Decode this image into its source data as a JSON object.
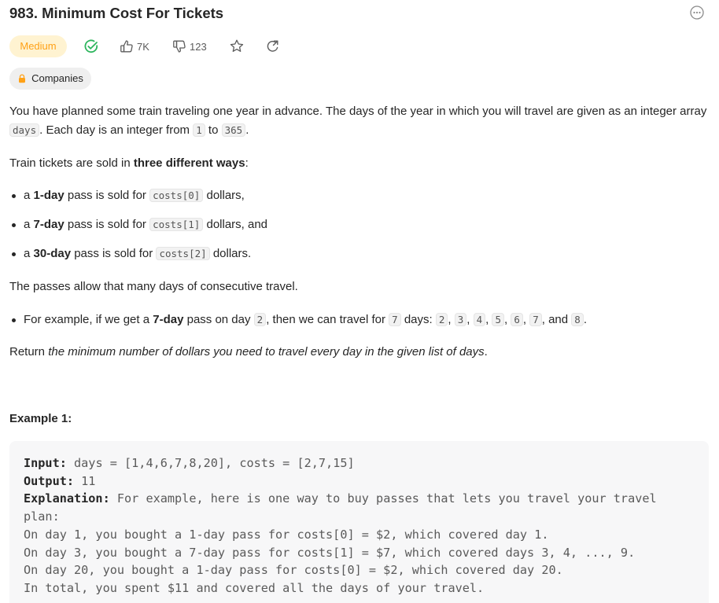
{
  "problem": {
    "title": "983. Minimum Cost For Tickets",
    "difficulty": "Medium",
    "likes": "7K",
    "dislikes": "123",
    "companies_label": "Companies"
  },
  "description": {
    "p1_a": "You have planned some train traveling one year in advance. The days of the year in which you will travel are given as an integer array ",
    "p1_code1": "days",
    "p1_b": ". Each day is an integer from ",
    "p1_code2": "1",
    "p1_c": " to ",
    "p1_code3": "365",
    "p1_d": ".",
    "p2_a": "Train tickets are sold in ",
    "p2_bold": "three different ways",
    "p2_b": ":",
    "passes": [
      {
        "pre": "a ",
        "bold": "1-day",
        "mid": " pass is sold for ",
        "code": "costs[0]",
        "post": " dollars,"
      },
      {
        "pre": "a ",
        "bold": "7-day",
        "mid": " pass is sold for ",
        "code": "costs[1]",
        "post": " dollars, and"
      },
      {
        "pre": "a ",
        "bold": "30-day",
        "mid": " pass is sold for ",
        "code": "costs[2]",
        "post": " dollars."
      }
    ],
    "p3": "The passes allow that many days of consecutive travel.",
    "example_bullet": {
      "a": "For example, if we get a ",
      "bold": "7-day",
      "b": " pass on day ",
      "code_day": "2",
      "c": ", then we can travel for ",
      "code_count": "7",
      "d": " days: ",
      "days": [
        "2",
        "3",
        "4",
        "5",
        "6",
        "7"
      ],
      "and": ", and ",
      "last": "8",
      "end": "."
    },
    "p4_a": "Return ",
    "p4_italic": "the minimum number of dollars you need to travel every day in the given list of days",
    "p4_b": "."
  },
  "example1": {
    "heading": "Example 1:",
    "input_label": "Input:",
    "input_value": " days = [1,4,6,7,8,20], costs = [2,7,15]",
    "output_label": "Output:",
    "output_value": " 11",
    "explanation_label": "Explanation:",
    "explanation_lines": [
      " For example, here is one way to buy passes that lets you travel your travel",
      "plan:",
      "On day 1, you bought a 1-day pass for costs[0] = $2, which covered day 1.",
      "On day 3, you bought a 7-day pass for costs[1] = $7, which covered days 3, 4, ..., 9.",
      "On day 20, you bought a 1-day pass for costs[0] = $2, which covered day 20.",
      "In total, you spent $11 and covered all the days of your travel."
    ]
  },
  "icons": {
    "more": "more-icon",
    "solved": "solved-check-icon",
    "like": "thumbs-up-icon",
    "dislike": "thumbs-down-icon",
    "favorite": "star-icon",
    "share": "share-icon",
    "lock": "lock-icon"
  },
  "colors": {
    "medium_text": "#ffa116",
    "medium_bg": "#fff3d1",
    "solved_green": "#2db55d"
  }
}
